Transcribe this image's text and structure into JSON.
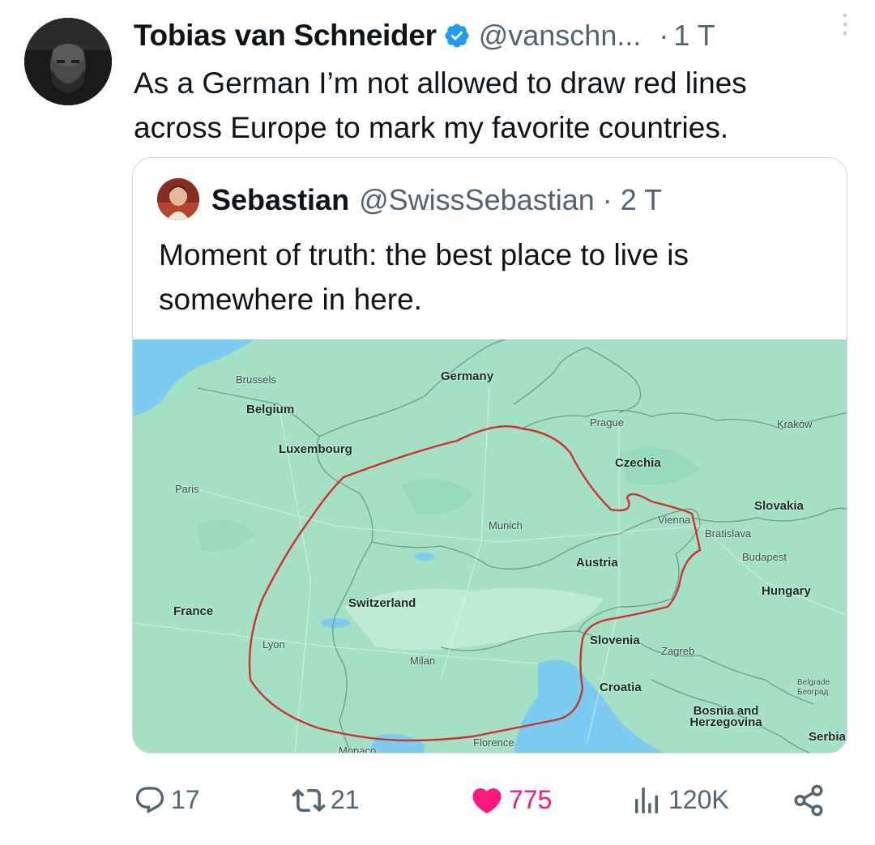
{
  "tweet": {
    "author": {
      "name": "Tobias van Schneider",
      "handle": "@vanschn...",
      "verified": true,
      "avatar_icon": "profile-photo"
    },
    "time": "1 T",
    "separator": "·",
    "text": "As a German I’m not allowed to draw red lines\nacross Europe to mark my favorite countries.",
    "more_icon": "more-vertical-icon"
  },
  "quote": {
    "author": {
      "name": "Sebastian",
      "handle": "@SwissSebastian",
      "avatar_icon": "profile-photo"
    },
    "separator": "·",
    "time": "2 T",
    "text": "Moment of truth: the best place to live is\nsomewhere in here.",
    "map": {
      "countries": [
        "Germany",
        "Belgium",
        "Luxembourg",
        "Czechia",
        "Slovakia",
        "Austria",
        "Hungary",
        "Switzerland",
        "France",
        "Slovenia",
        "Croatia",
        "Bosnia and Herzegovina",
        "Serbia"
      ],
      "cities": [
        "Brussels",
        "Prague",
        "Kraków",
        "Paris",
        "Munich",
        "Vienna",
        "Bratislava",
        "Budapest",
        "Lyon",
        "Milan",
        "Zagreb",
        "Belgrade",
        "Београд",
        "Florence",
        "Monaco"
      ],
      "outline_color": "#d0312d",
      "land_color": "#a4e0c4",
      "water_color": "#7ccbf0"
    }
  },
  "actions": {
    "reply": {
      "icon": "reply-icon",
      "count": "17"
    },
    "retweet": {
      "icon": "retweet-icon",
      "count": "21"
    },
    "like": {
      "icon": "heart-icon",
      "count": "775",
      "active": true,
      "color": "#f91880"
    },
    "views": {
      "icon": "views-icon",
      "count": "120K"
    },
    "share": {
      "icon": "share-icon"
    }
  },
  "colors": {
    "text": "#0f1419",
    "secondary": "#536471",
    "verified": "#1d9bf0",
    "border": "#cfd9de"
  }
}
